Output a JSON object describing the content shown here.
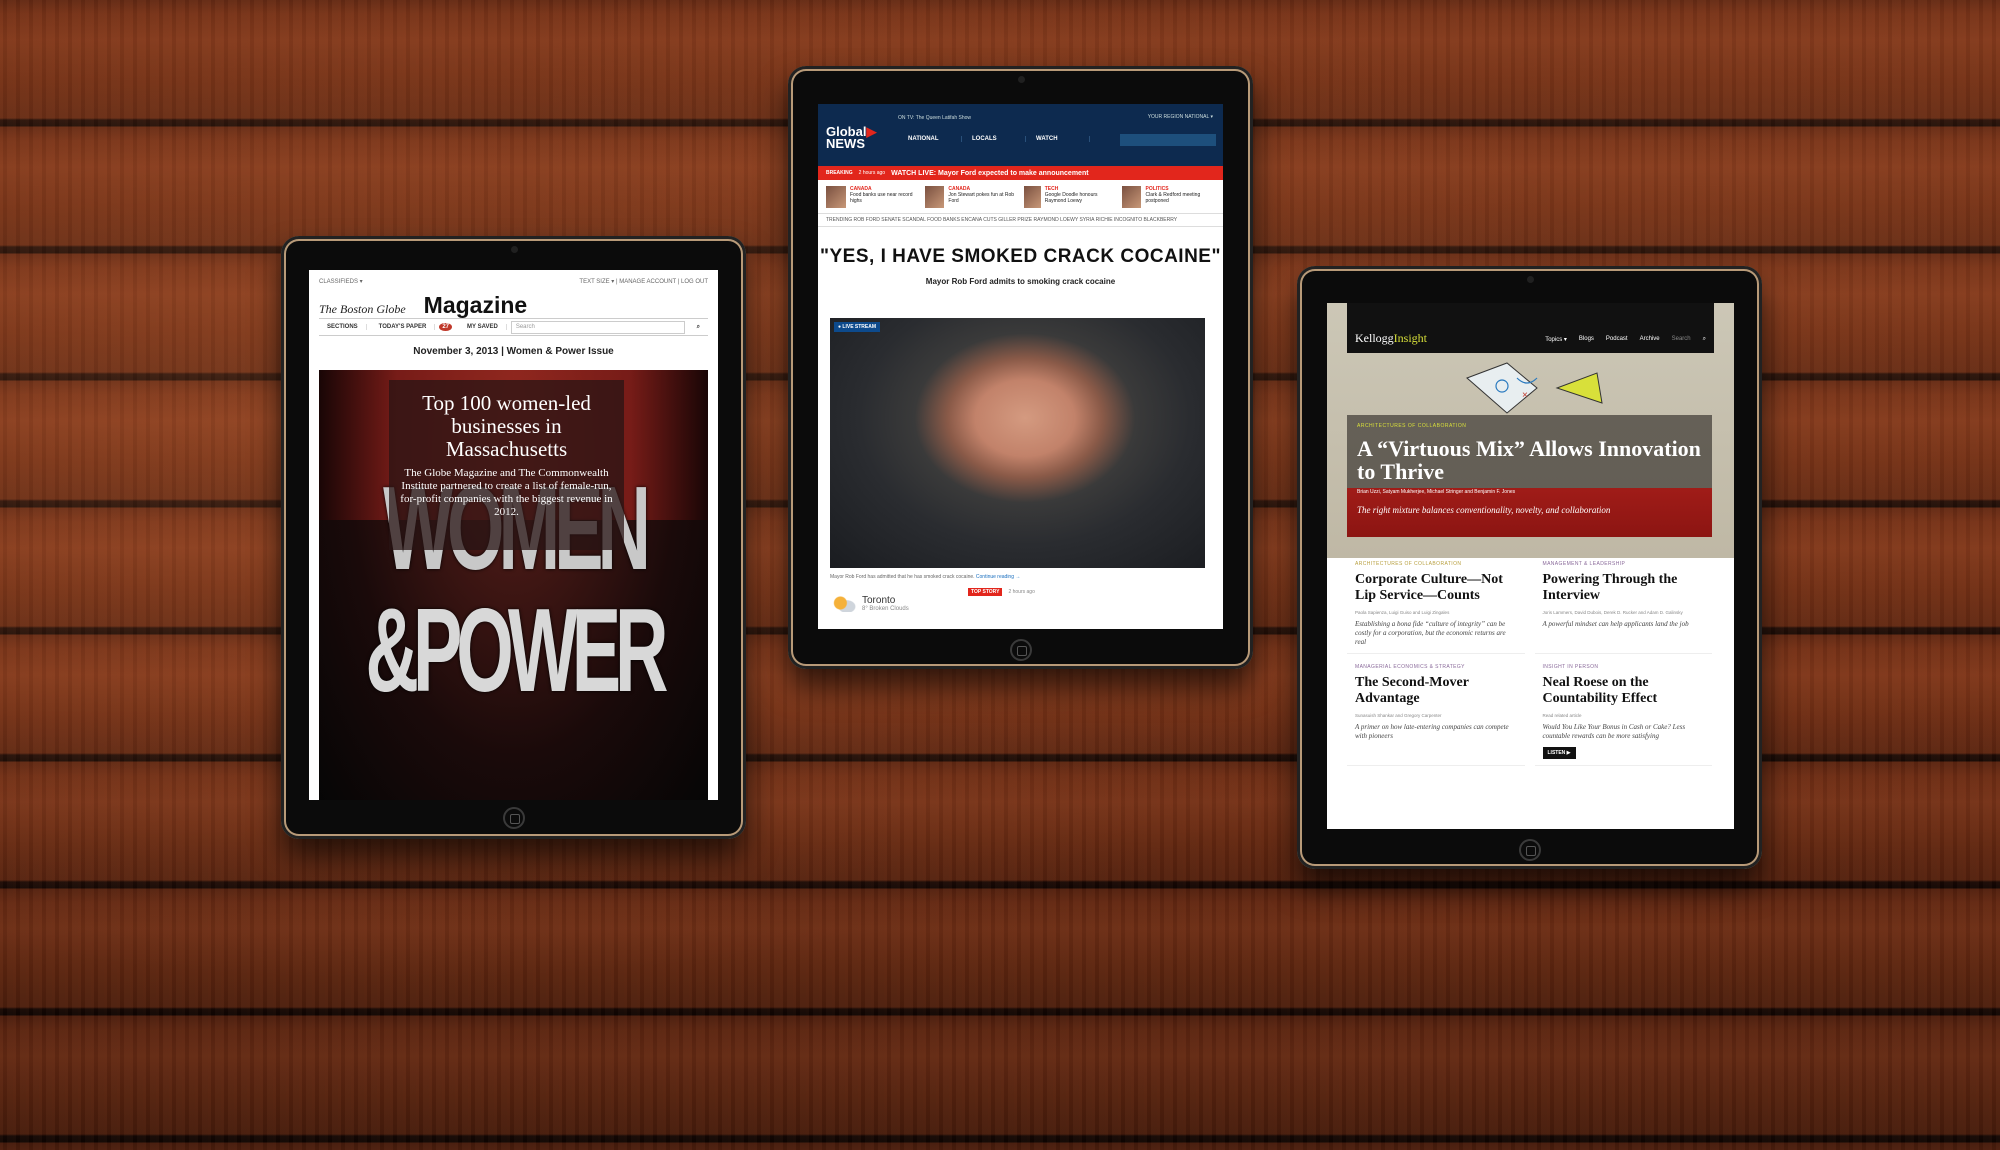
{
  "globe": {
    "classifieds": "CLASSIFIEDS ▾",
    "utils": "TEXT SIZE ▾ | MANAGE ACCOUNT | LOG OUT",
    "logo": "The Boston Globe",
    "section": "Magazine",
    "nav": [
      "SECTIONS",
      "TODAY'S PAPER"
    ],
    "saved_count": "27",
    "saved_label": "MY SAVED",
    "search_placeholder": "Search",
    "issue": "November 3, 2013 | Women & Power Issue",
    "headline": "Top 100 women-led businesses in Massachusetts",
    "dek": "The Globe Magazine and The Commonwealth Institute partnered to create a list of female-run, for-profit companies with the biggest revenue in 2012.",
    "cover_line1": "WOMEN",
    "cover_line2": "&POWER"
  },
  "global": {
    "logo_line1": "Global",
    "logo_line2": "NEWS",
    "on_tv": "ON TV: The Queen Latifah Show",
    "region": "YOUR REGION NATIONAL ▾",
    "nav": [
      "NATIONAL",
      "LOCALS",
      "WATCH"
    ],
    "breaking_tag": "BREAKING",
    "breaking_time": "2 hours ago",
    "breaking_text": "WATCH LIVE: Mayor Ford expected to make announcement",
    "strip": [
      {
        "cat": "CANADA",
        "text": "Food banks use near record highs"
      },
      {
        "cat": "CANADA",
        "text": "Jon Stewart pokes fun at Rob Ford"
      },
      {
        "cat": "TECH",
        "text": "Google Doodle honours Raymond Loewy"
      },
      {
        "cat": "POLITICS",
        "text": "Clark & Redford meeting postponed"
      }
    ],
    "trending": "TRENDING   ROB FORD   SENATE SCANDAL   FOOD BANKS   ENCANA CUTS   GILLER PRIZE   RAYMOND LOEWY   SYRIA   RICHIE INCOGNITO   BLACKBERRY",
    "title": "\"YES, I HAVE SMOKED CRACK COCAINE\"",
    "subtitle": "Mayor Rob Ford admits to smoking crack cocaine",
    "live_badge": "● LIVE STREAM",
    "caption": "Mayor Rob Ford has admitted that he has smoked crack cocaine.",
    "continue": "Continue reading →",
    "city": "Toronto",
    "temp": "8° Broken Clouds",
    "top_story": "TOP STORY",
    "top_time": "2 hours ago"
  },
  "kellogg": {
    "logo_a": "Kellogg",
    "logo_b": "Insight",
    "nav": [
      "Topics ▾",
      "Blogs",
      "Podcast",
      "Archive",
      "Search"
    ],
    "feat_tag": "ARCHITECTURES OF COLLABORATION",
    "feat_title": "A “Virtuous Mix” Allows Innovation to Thrive",
    "feat_authors": "Brian Uzzi, Satyam Mukherjee, Michael Stringer and Benjamin F. Jones",
    "feat_dek": "The right mixture balances conventionality, novelty, and collaboration",
    "cards": [
      {
        "tag": "ARCHITECTURES OF COLLABORATION",
        "title": "Corporate Culture—Not Lip Service—Counts",
        "by": "Paola Sapienza, Luigi Guiso and Luigi Zingales",
        "dek": "Establishing a bona fide “culture of integrity” can be costly for a corporation, but the economic returns are real"
      },
      {
        "tag": "MANAGEMENT & LEADERSHIP",
        "title": "Powering Through the Interview",
        "by": "Joris Lammers, David Dubois, Derek D. Rucker and Adam D. Galinsky",
        "dek": "A powerful mindset can help applicants land the job"
      },
      {
        "tag": "MANAGERIAL ECONOMICS & STRATEGY",
        "title": "The Second-Mover Advantage",
        "by": "Sunasuish Shankar and Gregory Carpenter",
        "dek": "A primer on how late-entering companies can compete with pioneers"
      },
      {
        "tag": "INSIGHT IN PERSON",
        "title": "Neal Roese on the Countability Effect",
        "by": "Read related article",
        "dek": "Would You Like Your Bonus in Cash or Cake? Less countable rewards can be more satisfying"
      }
    ],
    "listen": "LISTEN ▶"
  }
}
